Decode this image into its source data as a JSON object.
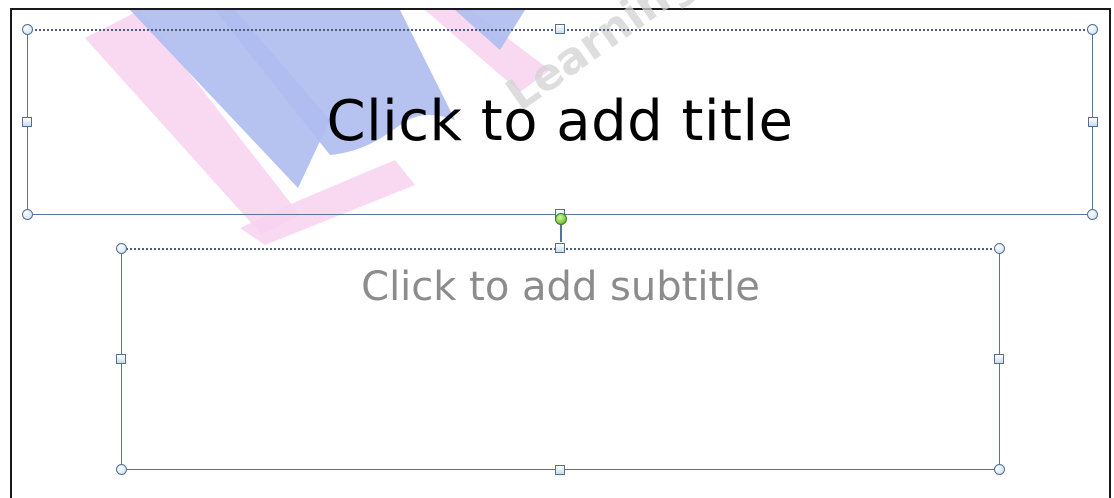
{
  "slide": {
    "title_placeholder": "Click to add title",
    "subtitle_placeholder": "Click to add subtitle"
  },
  "watermark": {
    "text": "Learning",
    "colors": {
      "blue": "#aebdf0",
      "pink": "#f8d2f0"
    }
  },
  "colors": {
    "selection_border": "#5b7396",
    "title_text": "#000000",
    "subtitle_text": "#8c8c8c",
    "rotate_handle": "#7fcf3c"
  }
}
